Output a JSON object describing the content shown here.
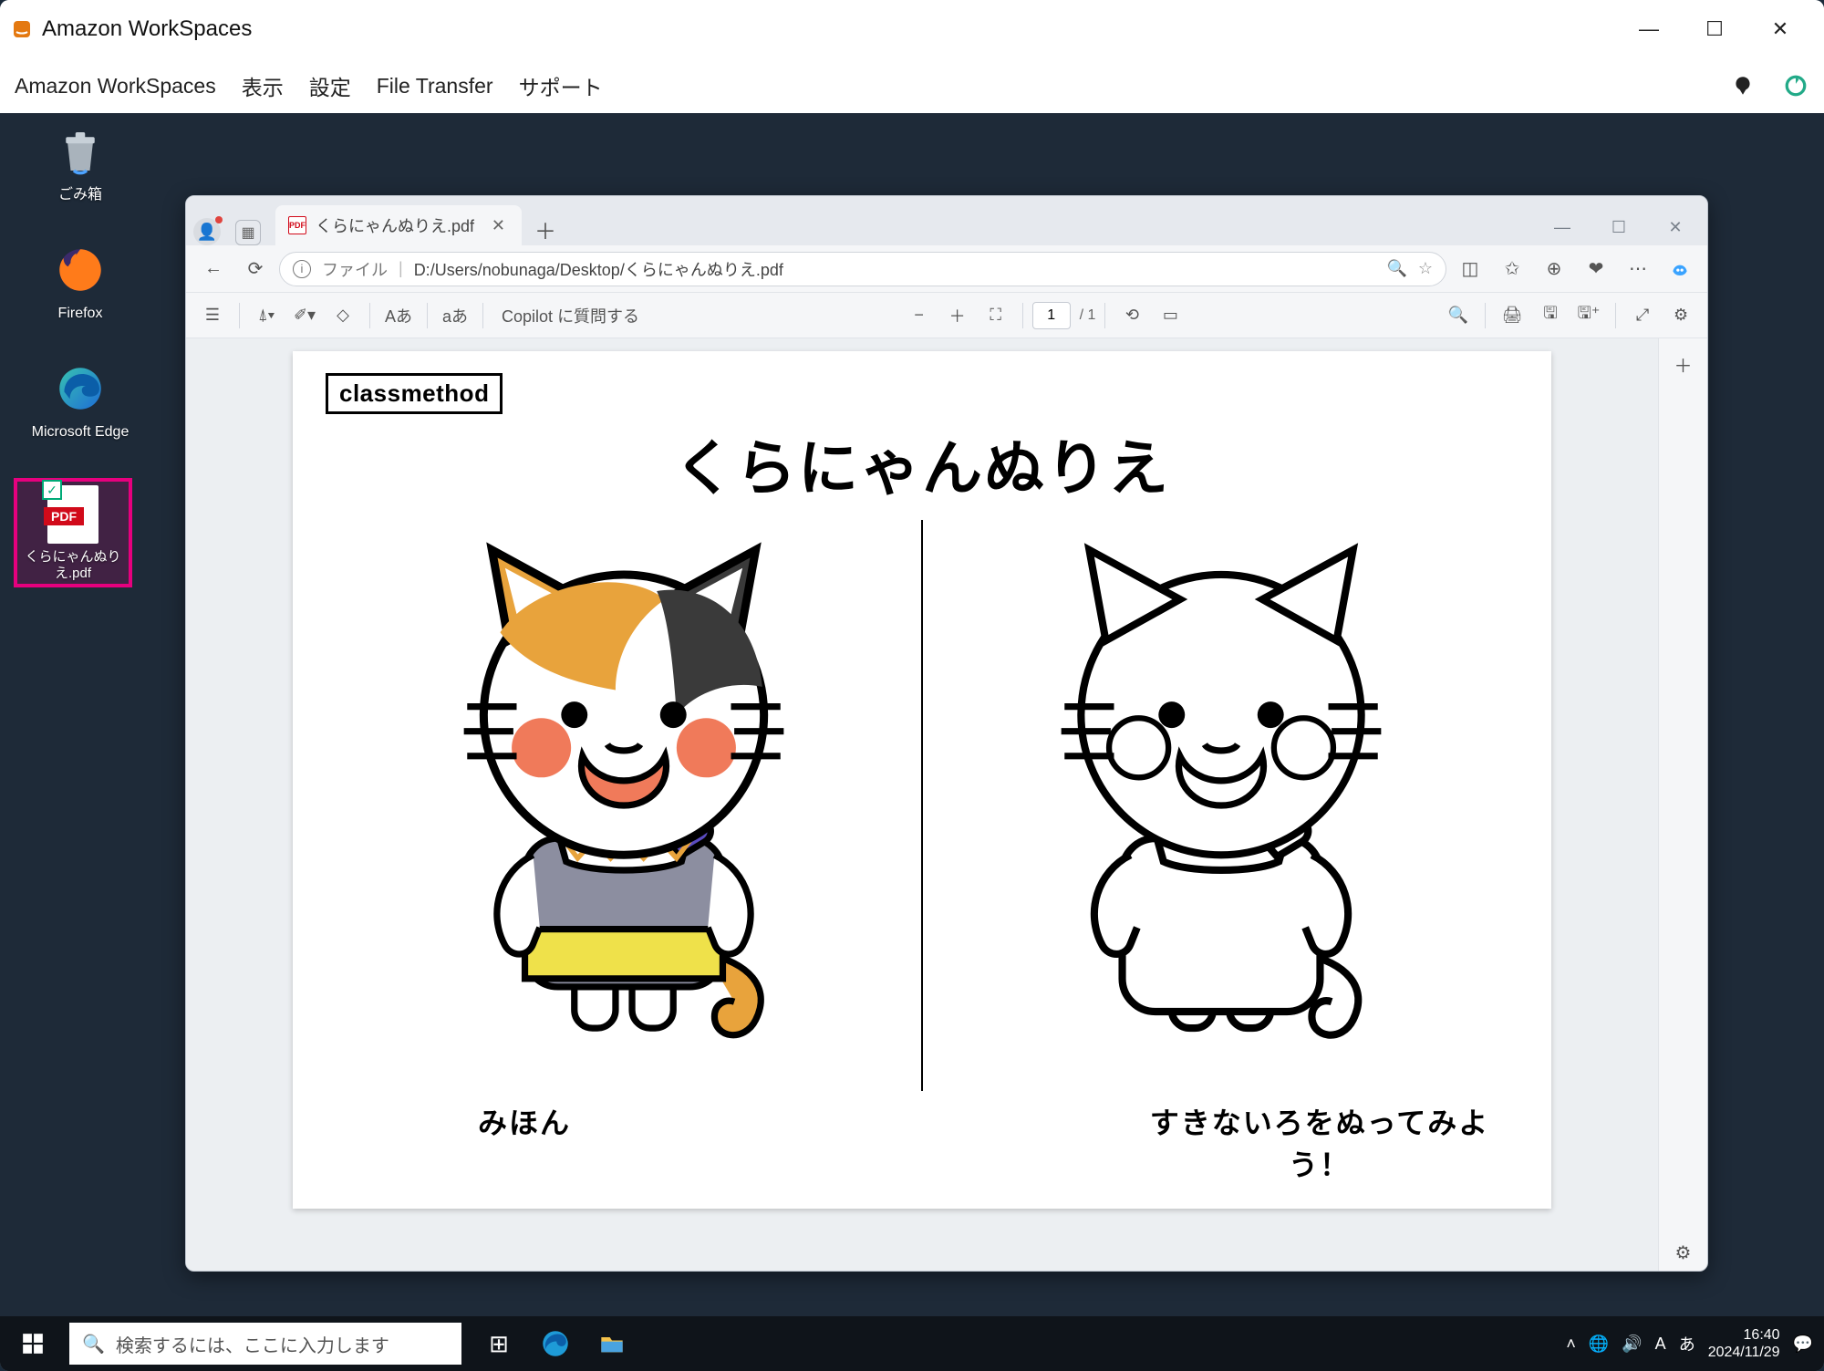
{
  "workspaces": {
    "title": "Amazon WorkSpaces",
    "menu": {
      "app": "Amazon WorkSpaces",
      "view": "表示",
      "settings": "設定",
      "file_transfer": "File Transfer",
      "support": "サポート"
    }
  },
  "desktop_icons": {
    "recycle_bin": "ごみ箱",
    "firefox": "Firefox",
    "edge": "Microsoft Edge",
    "pdf_file": "くらにゃんぬりえ.pdf"
  },
  "edge": {
    "tab_title": "くらにゃんぬりえ.pdf",
    "addr": {
      "scheme_label": "ファイル",
      "path": "D:/Users/nobunaga/Desktop/くらにゃんぬりえ.pdf"
    },
    "pdf_toolbar": {
      "copilot_label": "Copilot に質問する",
      "aa_label": "Aあ",
      "read_aloud_label": "aあ",
      "page_value": "1",
      "page_total": "/ 1"
    }
  },
  "pdf_document": {
    "brand": "classmethod",
    "title": "くらにゃんぬりえ",
    "caption_left": "みほん",
    "caption_right": "すきないろをぬってみよう！"
  },
  "taskbar": {
    "search_placeholder": "検索するには、ここに入力します",
    "ime": "A",
    "time": "16:40",
    "date": "2024/11/29"
  },
  "colors": {
    "highlight": "#e6007e",
    "cat_orange": "#e8a33c",
    "cat_blush": "#f07a5a",
    "cat_grey": "#3a3a3a",
    "cat_shirt": "#8c8ea0",
    "cat_shirt_yellow": "#efe14a"
  }
}
